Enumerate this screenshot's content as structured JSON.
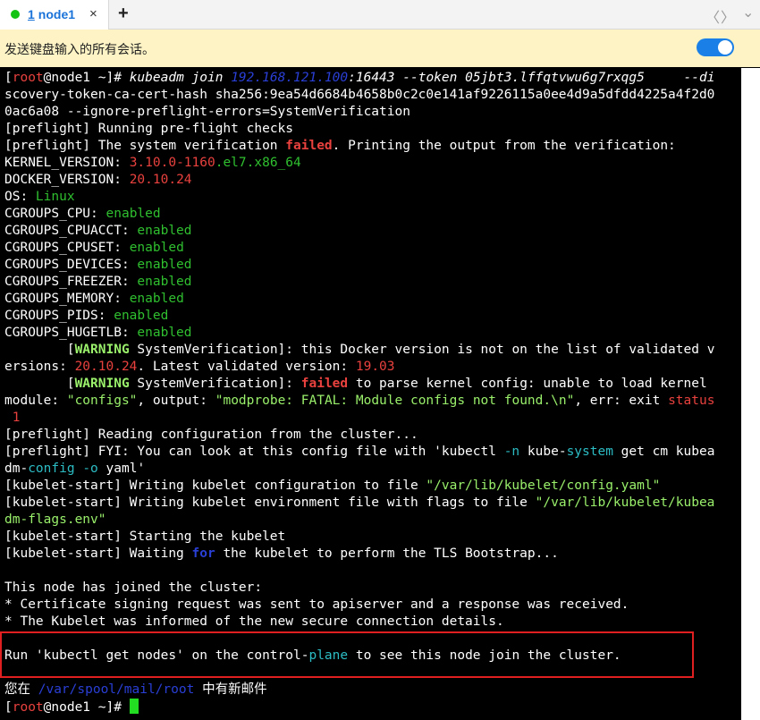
{
  "tab": {
    "number": "1",
    "title": "node1",
    "close": "×",
    "add": "+"
  },
  "nav": {
    "prev": "〈",
    "next": "〉",
    "menu": "⌄"
  },
  "banner": {
    "message": "发送键盘输入的所有会话。",
    "toggle_on": true
  },
  "colors": {
    "red": "#e8413e",
    "green": "#2fbf2f",
    "blue": "#2a3fd6",
    "cyan": "#2cbcc4",
    "default": "#ffffff",
    "bright_green": "#9af06b"
  },
  "terminal": {
    "lines": [
      [
        {
          "t": "["
        },
        {
          "t": "root",
          "c": "red"
        },
        {
          "t": "@node1 ~]# "
        },
        {
          "t": "kubeadm join ",
          "i": true
        },
        {
          "t": "192.168.121.100",
          "c": "blue",
          "i": true
        },
        {
          "t": ":16443 --token 05jbt3.lffqtvwu6g7rxqg5     --di",
          "i": true
        }
      ],
      [
        {
          "t": "scovery-token-ca-cert-hash sha256:9ea54d6684b4658b0c2c0e141af9226115a0ee4d9a5dfdd4225a4f2d0"
        }
      ],
      [
        {
          "t": "0ac6a08 --ignore-preflight-errors=SystemVerification"
        }
      ],
      [
        {
          "t": "[preflight] Running pre-"
        },
        {
          "t": "flight"
        },
        {
          "t": " checks"
        }
      ],
      [
        {
          "t": "[preflight] The system verification "
        },
        {
          "t": "failed",
          "c": "red",
          "b": true
        },
        {
          "t": ". Printing the output from the verification:"
        }
      ],
      [
        {
          "t": "KERNEL_VERSION: "
        },
        {
          "t": "3.10.0-1160",
          "c": "red"
        },
        {
          "t": ".el7.x86_64",
          "c": "green"
        }
      ],
      [
        {
          "t": "DOCKER_VERSION: "
        },
        {
          "t": "20.10.24",
          "c": "red"
        }
      ],
      [
        {
          "t": "OS: "
        },
        {
          "t": "Linux",
          "c": "green"
        }
      ],
      [
        {
          "t": "CGROUPS_CPU: "
        },
        {
          "t": "enabled",
          "c": "green"
        }
      ],
      [
        {
          "t": "CGROUPS_CPUACCT: "
        },
        {
          "t": "enabled",
          "c": "green"
        }
      ],
      [
        {
          "t": "CGROUPS_CPUSET: "
        },
        {
          "t": "enabled",
          "c": "green"
        }
      ],
      [
        {
          "t": "CGROUPS_DEVICES: "
        },
        {
          "t": "enabled",
          "c": "green"
        }
      ],
      [
        {
          "t": "CGROUPS_FREEZER: "
        },
        {
          "t": "enabled",
          "c": "green"
        }
      ],
      [
        {
          "t": "CGROUPS_MEMORY: "
        },
        {
          "t": "enabled",
          "c": "green"
        }
      ],
      [
        {
          "t": "CGROUPS_PIDS: "
        },
        {
          "t": "enabled",
          "c": "green"
        }
      ],
      [
        {
          "t": "CGROUPS_HUGETLB: "
        },
        {
          "t": "enabled",
          "c": "green"
        }
      ],
      [
        {
          "t": "        ["
        },
        {
          "t": "WARNING",
          "c": "bright_green",
          "b": true
        },
        {
          "t": " SystemVerification]: this Docker version is not on the list of validated v"
        }
      ],
      [
        {
          "t": "ersions: "
        },
        {
          "t": "20.10.24",
          "c": "red"
        },
        {
          "t": ". Latest validated version: "
        },
        {
          "t": "19.03",
          "c": "red"
        }
      ],
      [
        {
          "t": "        ["
        },
        {
          "t": "WARNING",
          "c": "bright_green",
          "b": true
        },
        {
          "t": " SystemVerification]: "
        },
        {
          "t": "failed",
          "c": "red",
          "b": true
        },
        {
          "t": " to parse kernel config: unable to load kernel"
        }
      ],
      [
        {
          "t": "module: "
        },
        {
          "t": "\"configs\"",
          "c": "bright_green"
        },
        {
          "t": ", output: "
        },
        {
          "t": "\"modprobe: FATAL: Module configs not found.\\n\"",
          "c": "bright_green"
        },
        {
          "t": ", err: exit "
        },
        {
          "t": "status",
          "c": "red"
        }
      ],
      [
        {
          "t": " 1",
          "c": "red"
        }
      ],
      [
        {
          "t": "[preflight] Reading configuration from the cluster..."
        }
      ],
      [
        {
          "t": "[preflight] FYI: You can look at this config file with 'kubectl "
        },
        {
          "t": "-n",
          "c": "cyan"
        },
        {
          "t": " kube-"
        },
        {
          "t": "system",
          "c": "cyan"
        },
        {
          "t": " get cm kubea"
        }
      ],
      [
        {
          "t": "dm-"
        },
        {
          "t": "config",
          "c": "cyan"
        },
        {
          "t": " -o",
          "c": "cyan"
        },
        {
          "t": " yaml'"
        }
      ],
      [
        {
          "t": "[kubelet-start] Writing kubelet configuration to file "
        },
        {
          "t": "\"/var/lib/kubelet/config.yaml\"",
          "c": "bright_green"
        }
      ],
      [
        {
          "t": "[kubelet-start] Writing kubelet environment file with flags to file "
        },
        {
          "t": "\"/var/lib/kubelet/kubea",
          "c": "bright_green"
        }
      ],
      [
        {
          "t": "dm-flags.env\"",
          "c": "bright_green"
        }
      ],
      [
        {
          "t": "[kubelet-start] Starting the kubelet"
        }
      ],
      [
        {
          "t": "[kubelet-start] Waiting "
        },
        {
          "t": "for",
          "c": "blue",
          "b": true
        },
        {
          "t": " the kubelet to perform the TLS Bootstrap..."
        }
      ],
      [
        {
          "t": ""
        }
      ],
      [
        {
          "t": "This node has joined the cluster:"
        }
      ],
      [
        {
          "t": "* Certificate signing request was sent to apiserver and a response was received."
        }
      ],
      [
        {
          "t": "* The Kubelet was informed of the new secure connection details."
        }
      ],
      [
        {
          "t": ""
        }
      ],
      [
        {
          "t": "Run 'kubectl get nodes' on the control-"
        },
        {
          "t": "plane",
          "c": "cyan"
        },
        {
          "t": " to see this node join the cluster."
        }
      ],
      [
        {
          "t": ""
        }
      ],
      [
        {
          "t": "您在 "
        },
        {
          "t": "/var/spool/mail/root",
          "c": "blue"
        },
        {
          "t": " 中有新邮件"
        }
      ],
      [
        {
          "t": "["
        },
        {
          "t": "root",
          "c": "red"
        },
        {
          "t": "@node1 ~]# "
        }
      ]
    ]
  }
}
